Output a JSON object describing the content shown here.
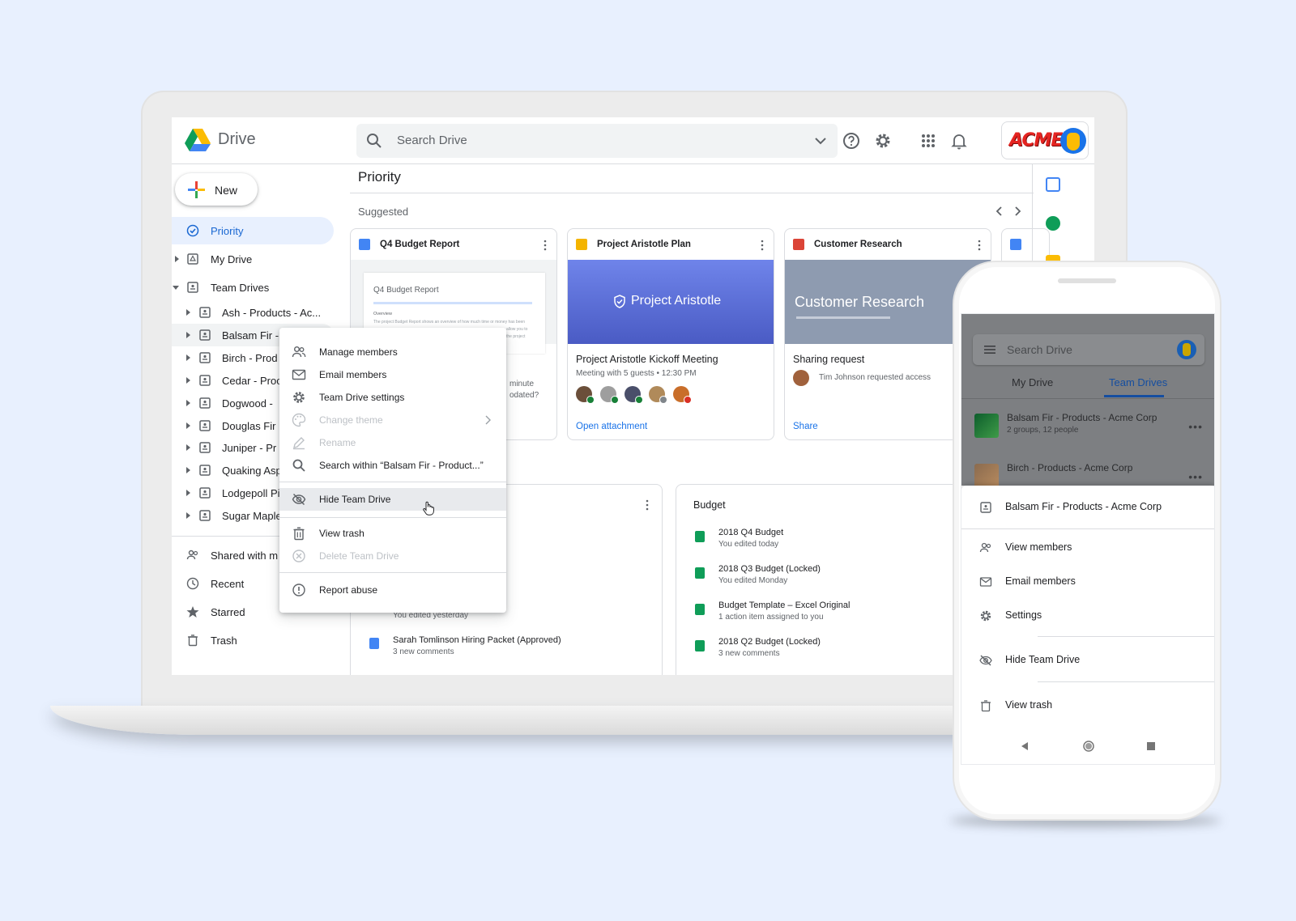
{
  "header": {
    "app_name": "Drive",
    "search_placeholder": "Search Drive",
    "brand_text": "ACME"
  },
  "sidebar": {
    "new_label": "New",
    "items": [
      {
        "label": "Priority"
      },
      {
        "label": "My Drive"
      },
      {
        "label": "Team Drives"
      }
    ],
    "team_drives": [
      {
        "label": "Ash - Products - Ac..."
      },
      {
        "label": "Balsam Fir -"
      },
      {
        "label": "Birch - Prod"
      },
      {
        "label": "Cedar - Proc"
      },
      {
        "label": "Dogwood -"
      },
      {
        "label": "Douglas Fir"
      },
      {
        "label": "Juniper - Pr"
      },
      {
        "label": "Quaking Asp"
      },
      {
        "label": "Lodgepoll Pi"
      },
      {
        "label": "Sugar Maple"
      }
    ],
    "bottom_items": [
      {
        "label": "Shared with m"
      },
      {
        "label": "Recent"
      },
      {
        "label": "Starred"
      },
      {
        "label": "Trash"
      }
    ]
  },
  "main": {
    "page_title": "Priority",
    "suggested_label": "Suggested",
    "cards": [
      {
        "file_name": "Q4 Budget Report",
        "doc_title": "Q4 Budget Report",
        "doc_heading": "Overview",
        "doc_body": "The project Budget Report shows an overview of how much time or money has been",
        "doc_body2": "allow you to",
        "doc_body3": "the project",
        "peek_line1": "minute",
        "peek_line2": "odated?"
      },
      {
        "file_name": "Project Aristotle Plan",
        "preview_title": "Project Aristotle",
        "title": "Project Aristotle Kickoff Meeting",
        "subtitle": "Meeting with 5 guests • 12:30 PM",
        "action": "Open attachment"
      },
      {
        "file_name": "Customer Research",
        "preview_title": "Customer Research",
        "title": "Sharing request",
        "subtitle": "Tim Johnson requested access",
        "action": "Share"
      }
    ],
    "left_panel": {
      "files": [
        {
          "name": "",
          "sub": "You edited yesterday"
        },
        {
          "name": "Sarah Tomlinson Hiring Packet (Approved)",
          "sub": "3 new comments"
        }
      ]
    },
    "budget_panel": {
      "title": "Budget",
      "files": [
        {
          "name": "2018 Q4 Budget",
          "sub": "You edited today",
          "type": "sheets"
        },
        {
          "name": "2018 Q3 Budget (Locked)",
          "sub": "You edited Monday",
          "type": "sheets"
        },
        {
          "name": "Budget Template – Excel Original",
          "sub": "1 action item assigned to you",
          "type": "excel"
        },
        {
          "name": "2018 Q2 Budget (Locked)",
          "sub": "3 new comments",
          "type": "sheets"
        }
      ]
    }
  },
  "context_menu": {
    "items": [
      {
        "label": "Manage members",
        "enabled": true
      },
      {
        "label": "Email members",
        "enabled": true
      },
      {
        "label": "Team Drive settings",
        "enabled": true
      },
      {
        "label": "Change theme",
        "enabled": false
      },
      {
        "label": "Rename",
        "enabled": false
      },
      {
        "label": "Search within “Balsam Fir - Product...”",
        "enabled": true
      },
      {
        "label": "Hide Team Drive",
        "enabled": true,
        "highlighted": true
      },
      {
        "label": "View trash",
        "enabled": true
      },
      {
        "label": "Delete Team Drive",
        "enabled": false
      },
      {
        "label": "Report abuse",
        "enabled": true
      }
    ]
  },
  "phone": {
    "search_placeholder": "Search Drive",
    "tabs": [
      "My Drive",
      "Team Drives"
    ],
    "active_tab": "Team Drives",
    "list": [
      {
        "name": "Balsam Fir - Products - Acme Corp",
        "sub": "2 groups, 12 people"
      },
      {
        "name": "Birch - Products - Acme Corp",
        "sub": ""
      }
    ],
    "sheet_title": "Balsam Fir - Products - Acme Corp",
    "sheet_items": [
      {
        "label": "View members"
      },
      {
        "label": "Email members"
      },
      {
        "label": "Settings"
      },
      {
        "label": "Hide Team Drive"
      },
      {
        "label": "View trash"
      }
    ]
  },
  "colors": {
    "accent": "#1a73e8",
    "active_nav_bg": "#e8f0fe",
    "aristotle_preview": "#5b6fd6",
    "research_preview": "#8e9bb0",
    "sheets_green": "#0f9d58",
    "acme_red": "#e52421"
  }
}
